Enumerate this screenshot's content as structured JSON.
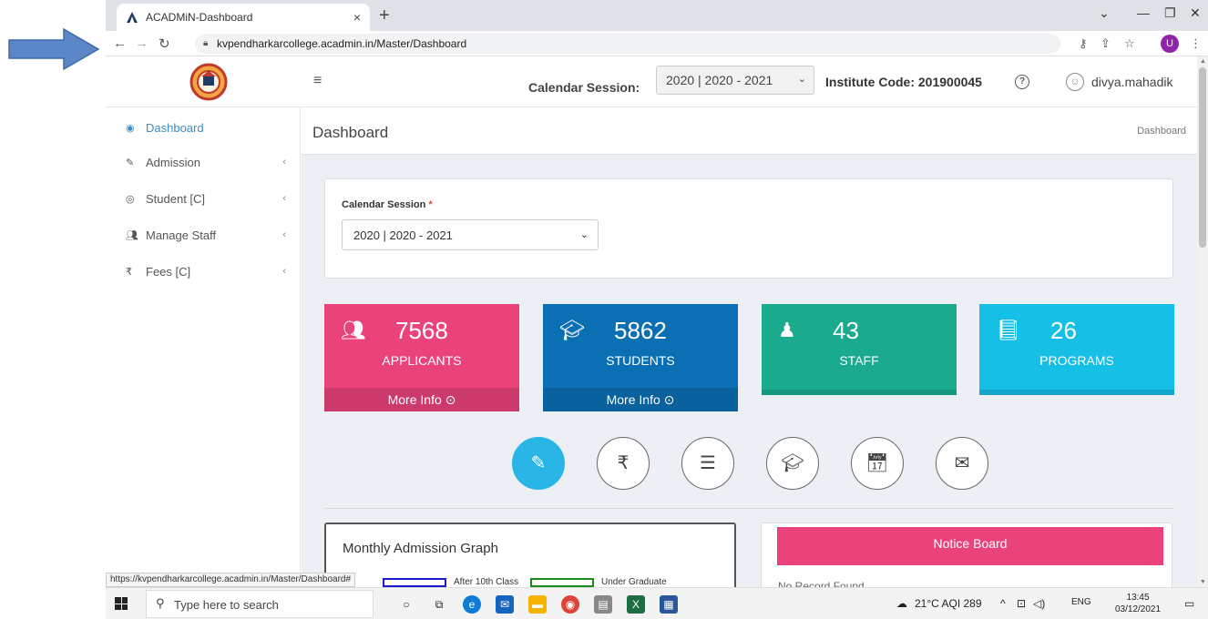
{
  "browser": {
    "tab_title": "ACADMiN-Dashboard",
    "tab_close": "×",
    "new_tab": "+",
    "url": "kvpendharkarcollege.acadmin.in/Master/Dashboard",
    "profile_initial": "U"
  },
  "header": {
    "menu_icon": "≡",
    "calendar_label": "Calendar Session:",
    "calendar_value": "2020 | 2020 - 2021",
    "institute_code": "Institute Code: 201900045",
    "help": "?",
    "username": "divya.mahadik"
  },
  "sidebar": {
    "items": [
      {
        "label": "Dashboard",
        "icon": "dashboard-icon"
      },
      {
        "label": "Admission",
        "icon": "edit-icon"
      },
      {
        "label": "Student [C]",
        "icon": "user-circle-icon"
      },
      {
        "label": "Manage Staff",
        "icon": "users-icon"
      },
      {
        "label": "Fees [C]",
        "icon": "rupee-icon"
      }
    ]
  },
  "page": {
    "title": "Dashboard",
    "breadcrumb": "Dashboard"
  },
  "filter": {
    "label": "Calendar Session",
    "required_mark": "*",
    "value": "2020 | 2020 - 2021"
  },
  "cards": [
    {
      "value": "7568",
      "label": "APPLICANTS",
      "more": "More Info ⊙",
      "color": "#e9437a",
      "icon": "users-icon"
    },
    {
      "value": "5862",
      "label": "STUDENTS",
      "more": "More Info ⊙",
      "color": "#0b6fb4",
      "icon": "graduation-cap-icon"
    },
    {
      "value": "43",
      "label": "STAFF",
      "more": "",
      "color": "#1aab8f",
      "icon": "person-icon"
    },
    {
      "value": "26",
      "label": "PROGRAMS",
      "more": "",
      "color": "#16bfe6",
      "icon": "book-icon"
    }
  ],
  "quick_actions": [
    "edit-icon",
    "rupee-icon",
    "list-icon",
    "graduation-cap-icon",
    "calendar-check-icon",
    "envelope-icon"
  ],
  "graph": {
    "title": "Monthly Admission Graph",
    "legend": [
      {
        "label": "After 10th Class",
        "color": "#1a1acc"
      },
      {
        "label": "Under Graduate",
        "color": "#1a8a1a"
      }
    ]
  },
  "notice": {
    "title": "Notice Board",
    "partial_text": "No Record Found"
  },
  "status_url": "https://kvpendharkarcollege.acadmin.in/Master/Dashboard#",
  "taskbar": {
    "search_placeholder": "Type here to search",
    "weather": "21°C  AQI 289",
    "language": "ENG",
    "time": "13:45",
    "date": "03/12/2021"
  }
}
